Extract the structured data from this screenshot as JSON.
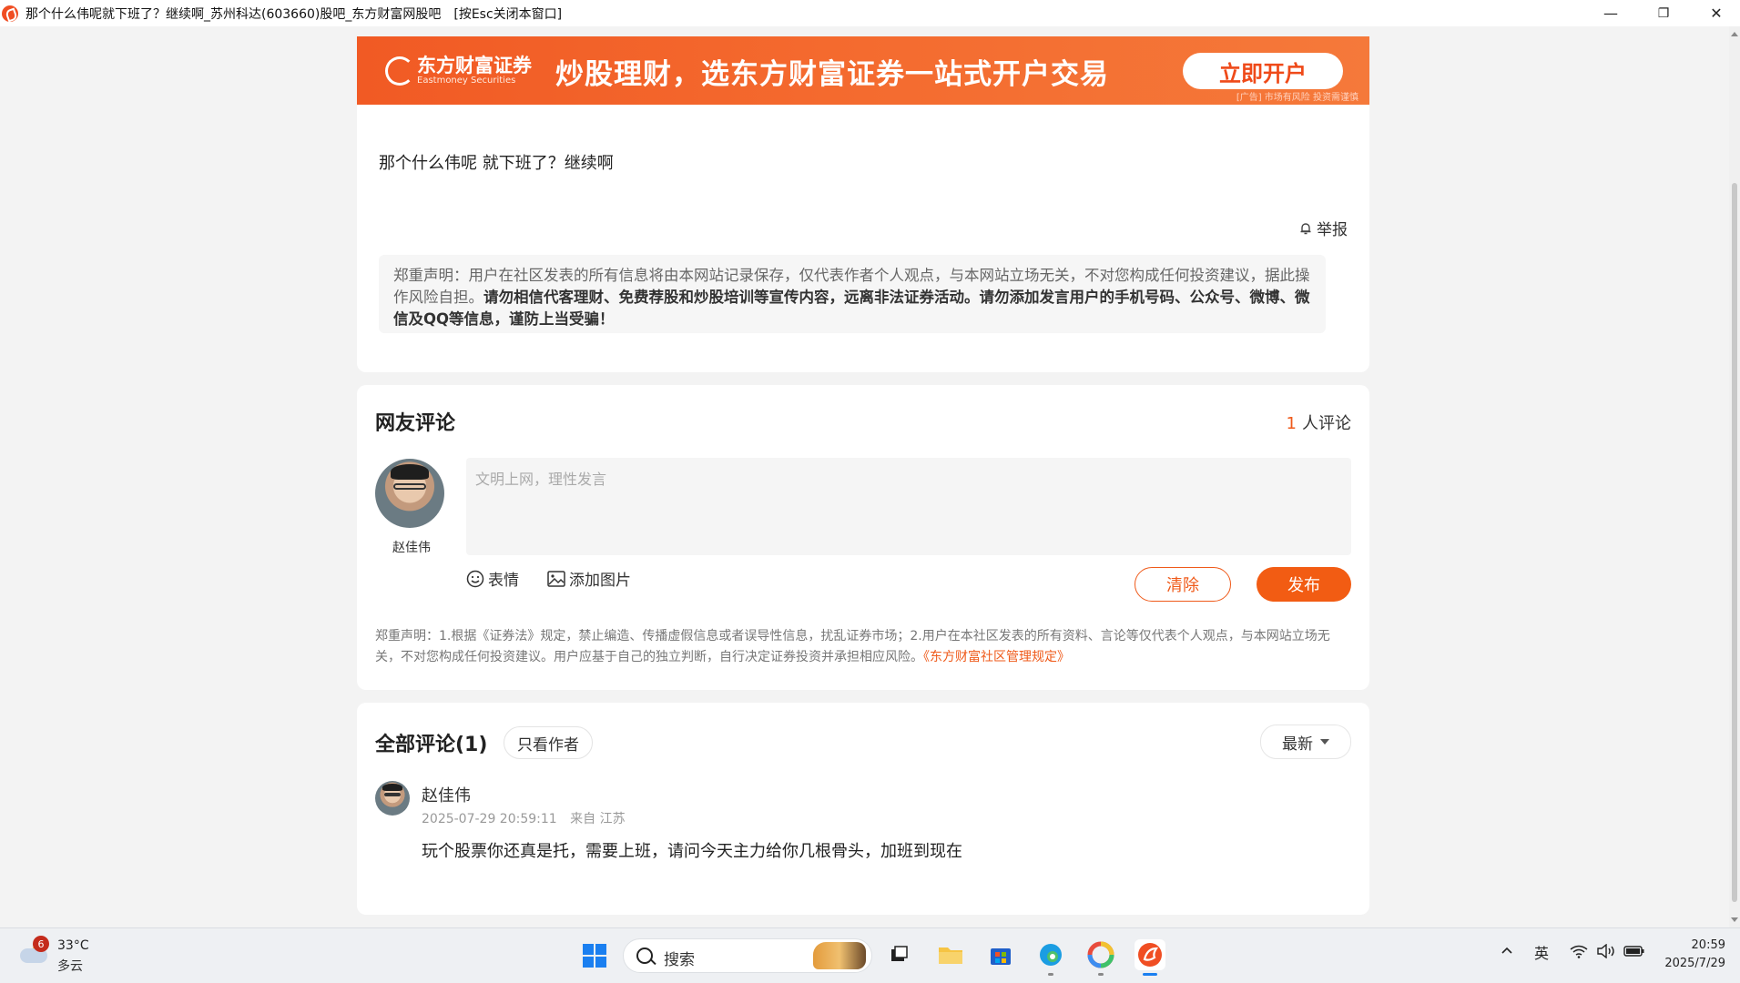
{
  "window": {
    "title": "那个什么伟呢就下班了？继续啊_苏州科达(603660)股吧_东方财富网股吧",
    "esc_hint": "[按Esc关闭本窗口]"
  },
  "banner": {
    "logo_cn": "东方财富证券",
    "logo_en": "Eastmoney Securities",
    "slogan": "炒股理财，选东方财富证券一站式开户交易",
    "cta": "立即开户",
    "ad_note": "[广告] 市场有风险 投资需谨慎"
  },
  "post": {
    "text": "那个什么伟呢 就下班了？继续啊",
    "report_label": "举报",
    "disclaimer_lead": "郑重声明：用户在社区发表的所有信息将由本网站记录保存，仅代表作者个人观点，与本网站立场无关，不对您构成任何投资建议，据此操作风险自担。",
    "disclaimer_bold": "请勿相信代客理财、免费荐股和炒股培训等宣传内容，远离非法证券活动。请勿添加发言用户的手机号码、公众号、微博、微信及QQ等信息，谨防上当受骗！"
  },
  "comment_box": {
    "title": "网友评论",
    "count_num": "1",
    "count_label": "人评论",
    "user_name": "赵佳伟",
    "placeholder": "文明上网，理性发言",
    "emoji_label": "表情",
    "image_label": "添加图片",
    "clear_label": "清除",
    "publish_label": "发布",
    "legal_text": "郑重声明：1.根据《证券法》规定，禁止编造、传播虚假信息或者误导性信息，扰乱证券市场；2.用户在本社区发表的所有资料、言论等仅代表个人观点，与本网站立场无关，不对您构成任何投资建议。用户应基于自己的独立判断，自行决定证券投资并承担相应风险。",
    "legal_link": "《东方财富社区管理规定》"
  },
  "all_comments": {
    "title": "全部评论(1)",
    "author_only": "只看作者",
    "sort_label": "最新",
    "items": [
      {
        "name": "赵佳伟",
        "time": "2025-07-29 20:59:11",
        "location": "来自 江苏",
        "text": "玩个股票你还真是托，需要上班，请问今天主力给你几根骨头，加班到现在"
      }
    ]
  },
  "taskbar": {
    "weather_badge": "6",
    "temperature": "33°C",
    "condition": "多云",
    "search_placeholder": "搜索",
    "input_method": "英",
    "time": "20:59",
    "date": "2025/7/29"
  }
}
